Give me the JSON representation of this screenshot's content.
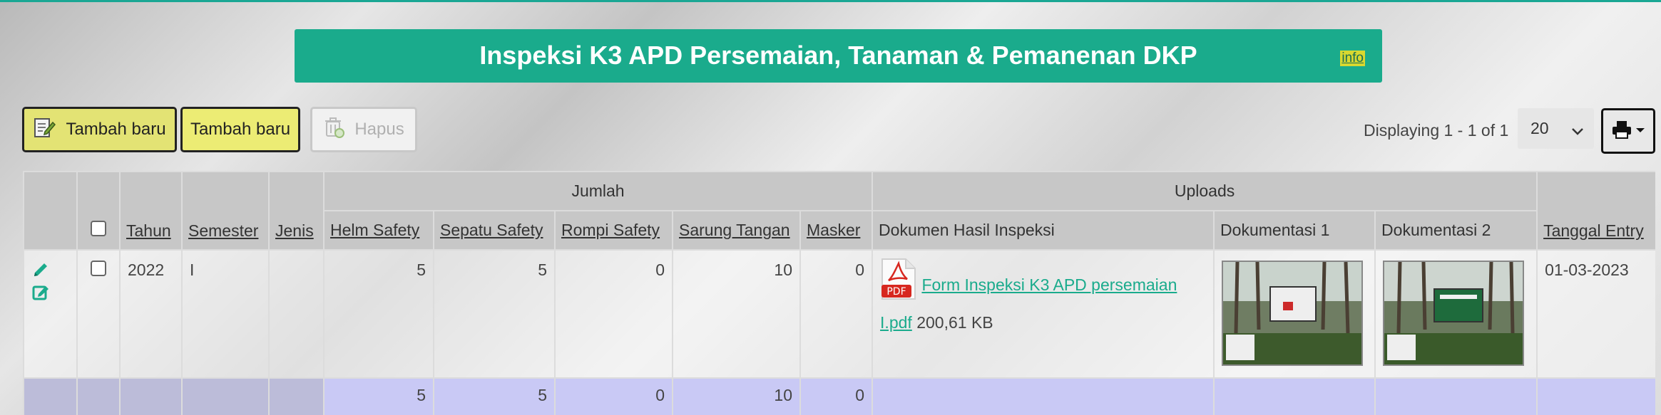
{
  "page": {
    "title": "Inspeksi K3 APD Persemaian, Tanaman & Pemanenan DKP",
    "info_label": "info"
  },
  "toolbar": {
    "add_label_1": "Tambah baru",
    "add_label_2": "Tambah baru",
    "delete_label": "Hapus",
    "displaying": "Displaying 1 - 1 of 1",
    "page_size": "20"
  },
  "table": {
    "group_jumlah": "Jumlah",
    "group_uploads": "Uploads",
    "headers": {
      "tahun": "Tahun",
      "semester": "Semester",
      "jenis": "Jenis",
      "helm": "Helm Safety",
      "sepatu": "Sepatu Safety",
      "rompi": "Rompi Safety",
      "sarung": "Sarung Tangan",
      "masker": "Masker",
      "dokumen": "Dokumen Hasil Inspeksi",
      "dok1": "Dokumentasi 1",
      "dok2": "Dokumentasi 2",
      "tanggal": "Tanggal Entry"
    },
    "rows": [
      {
        "tahun": "2022",
        "semester": "I",
        "jenis": "",
        "helm": "5",
        "sepatu": "5",
        "rompi": "0",
        "sarung": "10",
        "masker": "0",
        "file_name": "Form Inspeksi K3 APD persemaian I.pdf",
        "file_size": "200,61 KB",
        "tanggal": "01-03-2023"
      }
    ],
    "totals": {
      "helm": "5",
      "sepatu": "5",
      "rompi": "0",
      "sarung": "10",
      "masker": "0"
    }
  },
  "colors": {
    "accent": "#1aab8c",
    "add_button": "#e3e374",
    "total_row": "#c9c9f5"
  },
  "icons": [
    "edit-pencil-icon",
    "edit-note-icon",
    "pdf-icon",
    "print-icon",
    "trash-icon",
    "add-note-icon",
    "chevron-down-icon"
  ]
}
